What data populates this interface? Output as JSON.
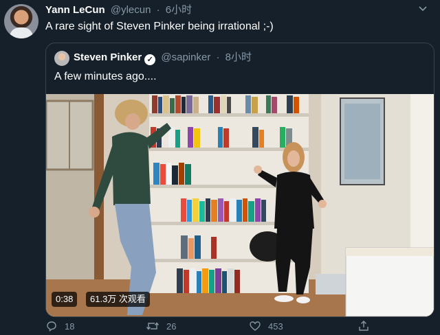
{
  "tweet": {
    "author_name": "Yann LeCun",
    "author_handle": "@ylecun",
    "separator": "·",
    "time": "6小时",
    "text": "A rare sight of Steven Pinker being irrational ;-)"
  },
  "quoted": {
    "author_name": "Steven Pinker",
    "author_handle": "@sapinker",
    "separator": "·",
    "time": "8小时",
    "text": "A few minutes ago....",
    "video": {
      "duration": "0:38",
      "views": "61.3万 次观看"
    }
  },
  "actions": {
    "reply_count": "18",
    "retweet_count": "26",
    "like_count": "453"
  },
  "icons": {
    "more": "chevron-down-icon",
    "verified": "verified-badge-icon",
    "reply": "reply-icon",
    "retweet": "retweet-icon",
    "like": "heart-icon",
    "share": "share-icon"
  },
  "colors": {
    "background": "#15202b",
    "border": "#38444d",
    "secondary_text": "#8899a6"
  }
}
